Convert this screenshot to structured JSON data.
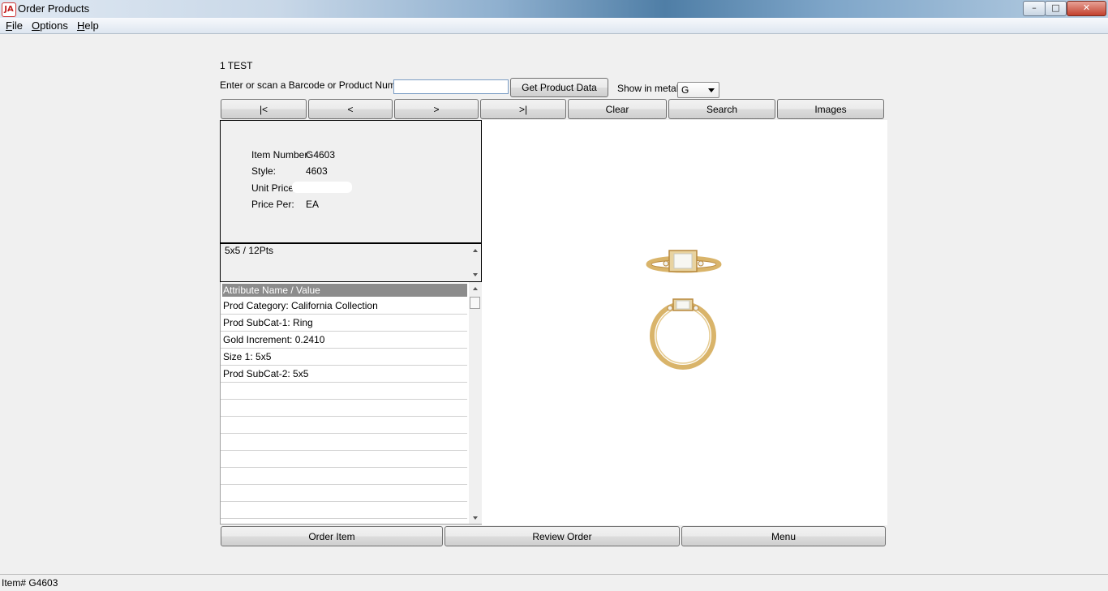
{
  "window": {
    "title": "Order Products",
    "icon_name": "app-logo-icon",
    "controls": {
      "minimize": "–",
      "maximize": "□",
      "close": "✕"
    }
  },
  "menu": [
    {
      "label": "File",
      "underline": "F",
      "rest": "ile"
    },
    {
      "label": "Options",
      "underline": "O",
      "rest": "ptions"
    },
    {
      "label": "Help",
      "underline": "H",
      "rest": "elp"
    }
  ],
  "customer": {
    "name": "1 TEST"
  },
  "lookup": {
    "label": "Enter or scan a Barcode or Product Number:",
    "value": "",
    "get_button": "Get Product Data",
    "metal_label": "Show in metal:",
    "metal_value": "G"
  },
  "nav": {
    "first": "|<",
    "prev": "<",
    "next": ">",
    "last": ">|",
    "clear": "Clear",
    "search": "Search",
    "images": "Images"
  },
  "product": {
    "item_number_label": "Item Number:",
    "item_number": "G4603",
    "style_label": "Style:",
    "style": "4603",
    "unit_price_label": "Unit Price:",
    "unit_price": "",
    "price_per_label": "Price Per:",
    "price_per": "EA"
  },
  "description": "5x5 / 12Pts",
  "attributes": {
    "header": "Attribute Name / Value",
    "rows": [
      "Prod Category: California Collection",
      "Prod SubCat-1: Ring",
      "Gold Increment: 0.2410",
      "Size 1: 5x5",
      "Prod SubCat-2: 5x5",
      "",
      "",
      "",
      "",
      "",
      "",
      "",
      ""
    ]
  },
  "actions": {
    "order_item": "Order Item",
    "review_order": "Review Order",
    "menu": "Menu"
  },
  "status": {
    "text": "Item# G4603"
  },
  "colors": {
    "gold": "#d9b46a",
    "gold_dark": "#b8893f",
    "grid_header": "#8c8c8c"
  }
}
